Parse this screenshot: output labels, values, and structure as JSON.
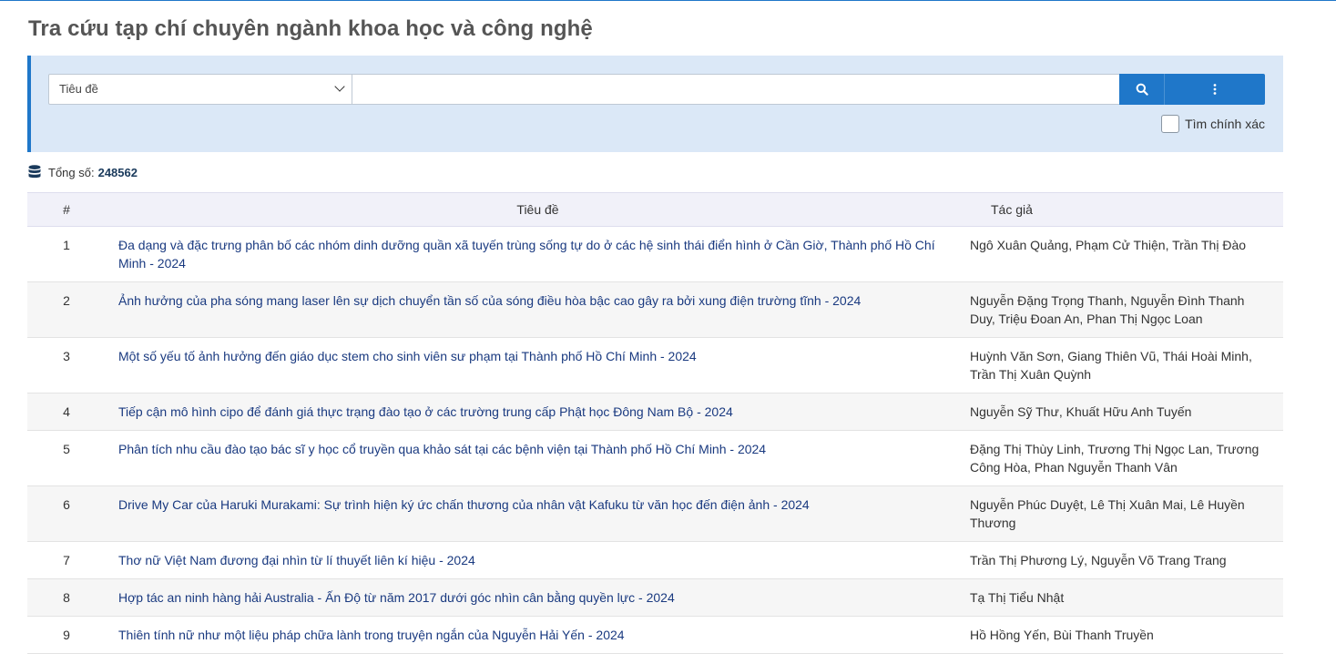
{
  "page": {
    "title": "Tra cứu tạp chí chuyên ngành khoa học và công nghệ"
  },
  "search": {
    "field_selected": "Tiêu đề",
    "query_value": "",
    "search_icon": "search-icon",
    "more_icon": "vertical-ellipsis-icon",
    "exact_label": "Tìm chính xác",
    "exact_checked": false
  },
  "summary": {
    "icon": "database-icon",
    "label": "Tổng số:",
    "count": "248562"
  },
  "table": {
    "headers": {
      "num": "#",
      "title": "Tiêu đề",
      "authors": "Tác giả"
    },
    "rows": [
      {
        "num": "1",
        "title": "Đa dạng và đặc trưng phân bố các nhóm dinh dưỡng quần xã tuyến trùng sống tự do ở các hệ sinh thái điển hình ở Cần Giờ, Thành phố Hồ Chí Minh - 2024",
        "authors": "Ngô Xuân Quảng, Phạm Cử Thiện, Trần Thị Đào"
      },
      {
        "num": "2",
        "title": "Ảnh hưởng của pha sóng mang laser lên sự dịch chuyển tần số của sóng điều hòa bậc cao gây ra bởi xung điện trường tĩnh - 2024",
        "authors": "Nguyễn Đặng Trọng Thanh, Nguyễn Đình Thanh Duy, Triệu Đoan An, Phan Thị Ngọc Loan"
      },
      {
        "num": "3",
        "title": "Một số yếu tố ảnh hưởng đến giáo dục stem cho sinh viên sư phạm tại Thành phố Hồ Chí Minh - 2024",
        "authors": "Huỳnh Văn Sơn, Giang Thiên Vũ, Thái Hoài Minh, Trần Thị Xuân Quỳnh"
      },
      {
        "num": "4",
        "title": "Tiếp cận mô hình cipo để đánh giá thực trạng đào tạo ở các trường trung cấp Phật học Đông Nam Bộ - 2024",
        "authors": "Nguyễn Sỹ Thư, Khuất Hữu Anh Tuyến"
      },
      {
        "num": "5",
        "title": "Phân tích nhu cầu đào tạo bác sĩ y học cổ truyền qua khảo sát tại các bệnh viện tại Thành phố Hồ Chí Minh - 2024",
        "authors": "Đặng Thị Thùy Linh, Trương Thị Ngọc Lan, Trương Công Hòa, Phan Nguyễn Thanh Vân"
      },
      {
        "num": "6",
        "title": "Drive My Car của Haruki Murakami: Sự trình hiện ký ức chấn thương của nhân vật Kafuku từ văn học đến điện ảnh - 2024",
        "authors": "Nguyễn Phúc Duyệt, Lê Thị Xuân Mai, Lê Huyền Thương"
      },
      {
        "num": "7",
        "title": "Thơ nữ Việt Nam đương đại nhìn từ lí thuyết liên kí hiệu - 2024",
        "authors": "Trần Thị Phương Lý, Nguyễn Võ Trang Trang"
      },
      {
        "num": "8",
        "title": "Hợp tác an ninh hàng hải Australia - Ấn Độ từ năm 2017 dưới góc nhìn cân bằng quyền lực - 2024",
        "authors": "Tạ Thị Tiểu Nhật"
      },
      {
        "num": "9",
        "title": "Thiên tính nữ như một liệu pháp chữa lành trong truyện ngắn của Nguyễn Hải Yến - 2024",
        "authors": "Hồ Hồng Yến, Bùi Thanh Truyền"
      }
    ]
  },
  "colors": {
    "accent": "#1f77c9",
    "panel_bg": "#dbe8f7",
    "link": "#1a3a80",
    "header_bg": "#f1f1f9"
  }
}
